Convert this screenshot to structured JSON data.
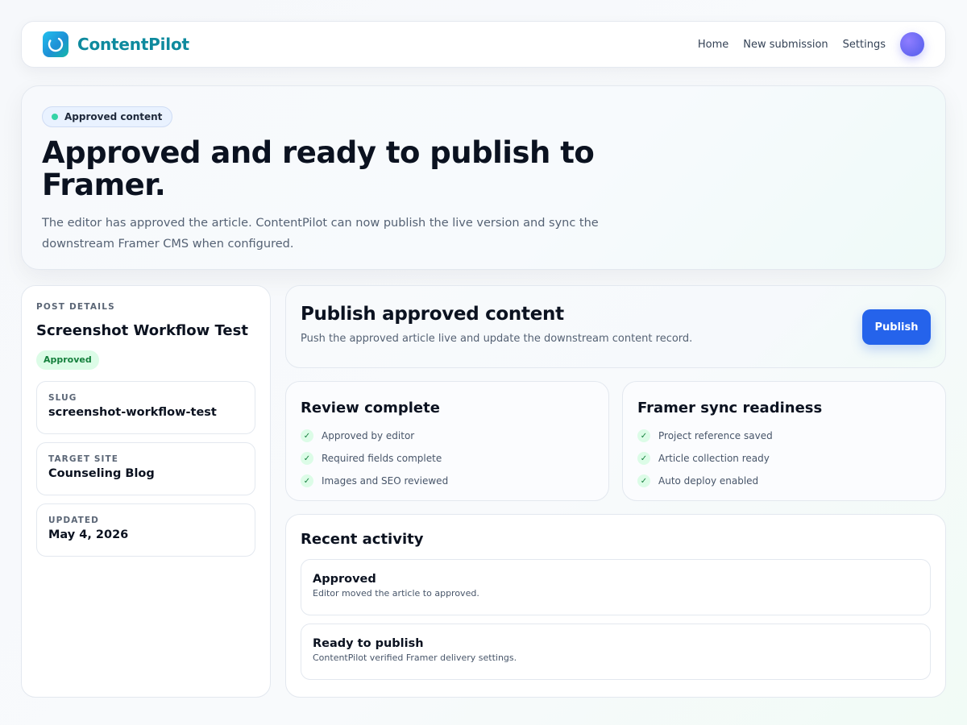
{
  "header": {
    "brand": "ContentPilot",
    "logo_icon": "spinner-ring-icon",
    "nav": [
      {
        "label": "Home"
      },
      {
        "label": "New submission"
      },
      {
        "label": "Settings"
      }
    ],
    "avatar_color": "#6366f1"
  },
  "hero": {
    "badge": "Approved content",
    "title": "Approved and ready to publish to Framer.",
    "description": "The editor has approved the article. ContentPilot can now publish the live version and sync the downstream Framer CMS when configured."
  },
  "post_details": {
    "eyebrow": "POST DETAILS",
    "title": "Screenshot Workflow Test",
    "status": "Approved",
    "meta": [
      {
        "label": "SLUG",
        "value": "screenshot-workflow-test"
      },
      {
        "label": "TARGET SITE",
        "value": "Counseling Blog"
      },
      {
        "label": "UPDATED",
        "value": "May 4, 2026"
      }
    ]
  },
  "publish": {
    "title": "Publish approved content",
    "description": "Push the approved article live and update the downstream content record.",
    "button_label": "Publish",
    "button_color": "#2563eb"
  },
  "review": {
    "title": "Review complete",
    "items": [
      "Approved by editor",
      "Required fields complete",
      "Images and SEO reviewed"
    ]
  },
  "framer_sync": {
    "title": "Framer sync readiness",
    "items": [
      "Project reference saved",
      "Article collection ready",
      "Auto deploy enabled"
    ]
  },
  "activity": {
    "title": "Recent activity",
    "items": [
      {
        "title": "Approved",
        "description": "Editor moved the article to approved."
      },
      {
        "title": "Ready to publish",
        "description": "ContentPilot verified Framer delivery settings."
      }
    ]
  },
  "colors": {
    "accent_teal": "#0e8a9e",
    "success_green": "#15803d",
    "success_bg": "#dcfce7"
  }
}
